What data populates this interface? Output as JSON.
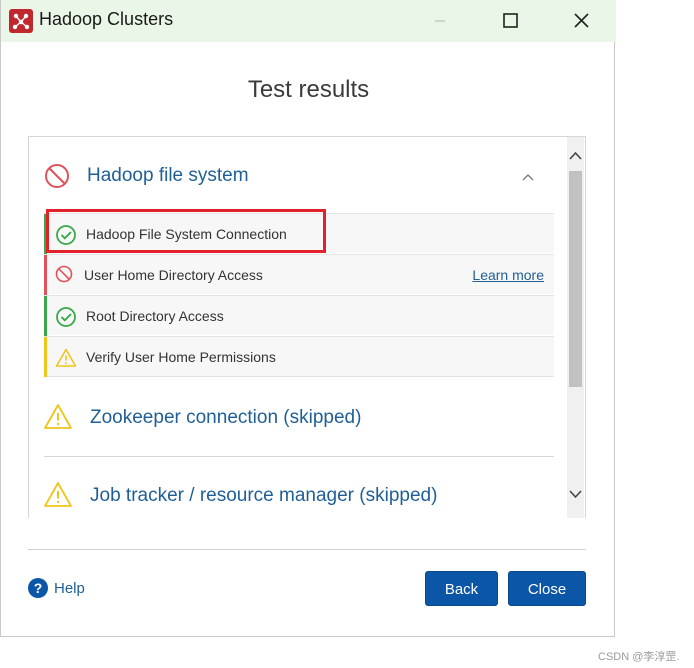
{
  "window": {
    "title": "Hadoop Clusters",
    "app_icon": "hadoop-cluster-icon"
  },
  "heading": "Test results",
  "sections": [
    {
      "title": "Hadoop file system",
      "status": "error",
      "expanded": true,
      "items": [
        {
          "label": "Hadoop File System Connection",
          "status": "success",
          "highlighted": true
        },
        {
          "label": "User Home Directory Access",
          "status": "error",
          "link": "Learn more"
        },
        {
          "label": "Root Directory Access",
          "status": "success"
        },
        {
          "label": "Verify User Home Permissions",
          "status": "warning"
        }
      ]
    },
    {
      "title": "Zookeeper connection (skipped)",
      "status": "warning"
    },
    {
      "title": "Job tracker / resource manager (skipped)",
      "status": "warning"
    }
  ],
  "footer": {
    "help": "Help",
    "back": "Back",
    "close": "Close"
  },
  "colors": {
    "error": "#e0525a",
    "success": "#3aa84a",
    "warning": "#f0c419",
    "accent": "#0b56a6"
  },
  "watermark": "CSDN @李淳罡."
}
